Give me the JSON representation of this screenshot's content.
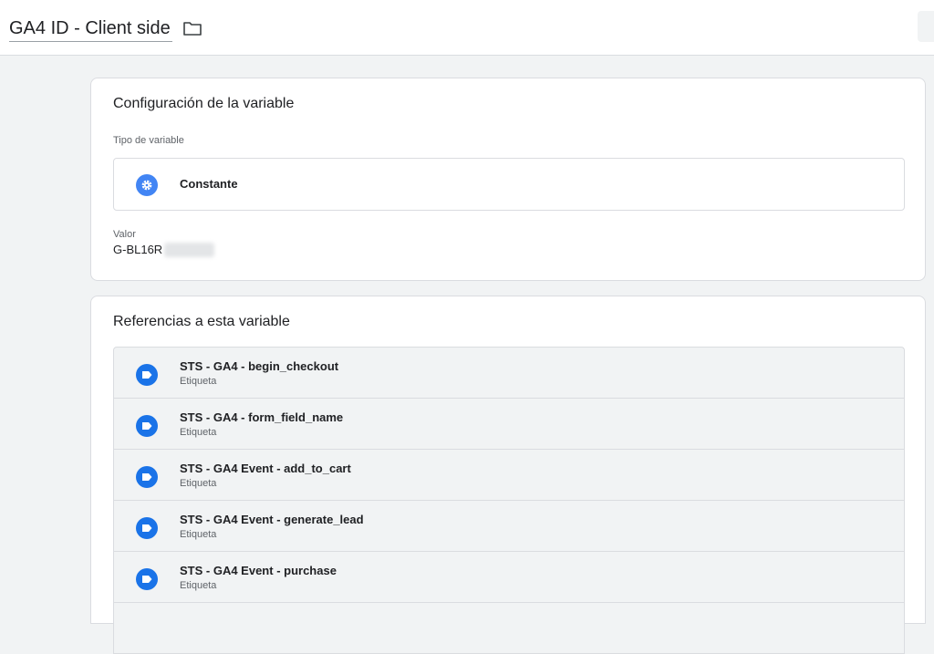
{
  "header": {
    "title": "GA4 ID - Client side"
  },
  "config": {
    "title": "Configuración de la variable",
    "type_label": "Tipo de variable",
    "type_name": "Constante",
    "value_label": "Valor",
    "value": "G-BL16R"
  },
  "references": {
    "title": "Referencias a esta variable",
    "items": [
      {
        "name": "STS - GA4 - begin_checkout",
        "type": "Etiqueta"
      },
      {
        "name": "STS - GA4 - form_field_name",
        "type": "Etiqueta"
      },
      {
        "name": "STS - GA4 Event - add_to_cart",
        "type": "Etiqueta"
      },
      {
        "name": "STS - GA4 Event - generate_lead",
        "type": "Etiqueta"
      },
      {
        "name": "STS - GA4 Event - purchase",
        "type": "Etiqueta"
      },
      {
        "name": "",
        "type": ""
      }
    ]
  },
  "colors": {
    "accent": "#4285f4",
    "tag_icon": "#1a73e8"
  },
  "icons": {
    "folder": "folder-icon",
    "type": "gear-icon",
    "tag": "tag-icon"
  }
}
